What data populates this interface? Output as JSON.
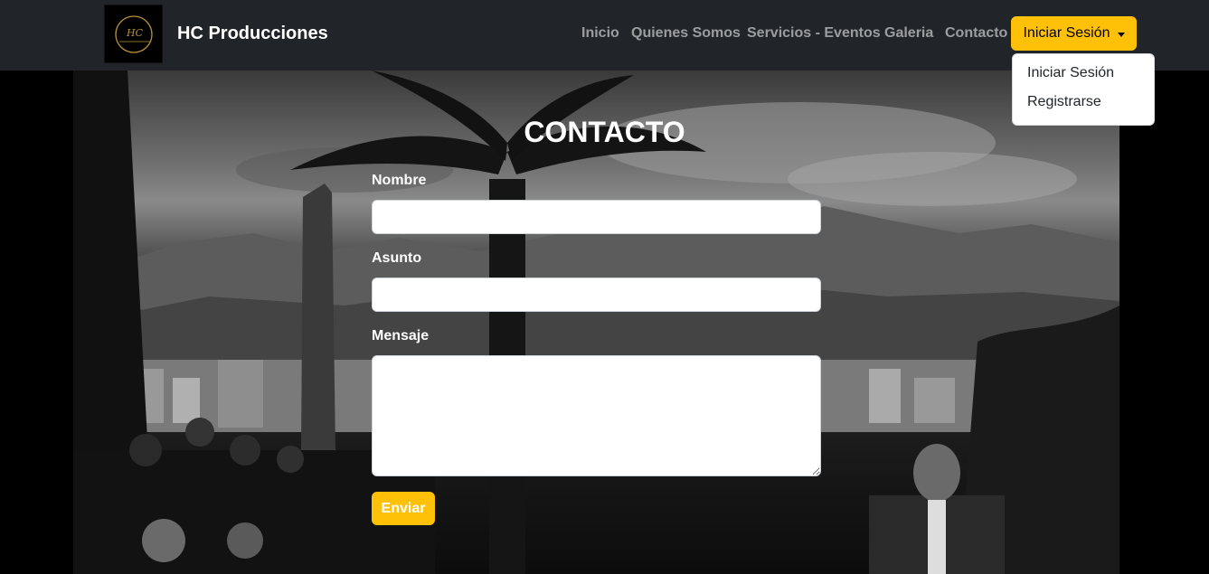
{
  "navbar": {
    "brand_name": "HC Producciones",
    "logo_text": "HC",
    "links": [
      "Inicio",
      "Quienes Somos",
      "Servicios - Eventos",
      "Galeria",
      "Contacto"
    ],
    "login_button": "Iniciar Sesión"
  },
  "dropdown": {
    "items": [
      "Iniciar Sesión",
      "Registrarse"
    ]
  },
  "form": {
    "title": "CONTACTO",
    "fields": {
      "name_label": "Nombre",
      "subject_label": "Asunto",
      "message_label": "Mensaje"
    },
    "submit_label": "Enviar"
  },
  "colors": {
    "navbar_bg": "#212529",
    "accent": "#ffc107"
  }
}
